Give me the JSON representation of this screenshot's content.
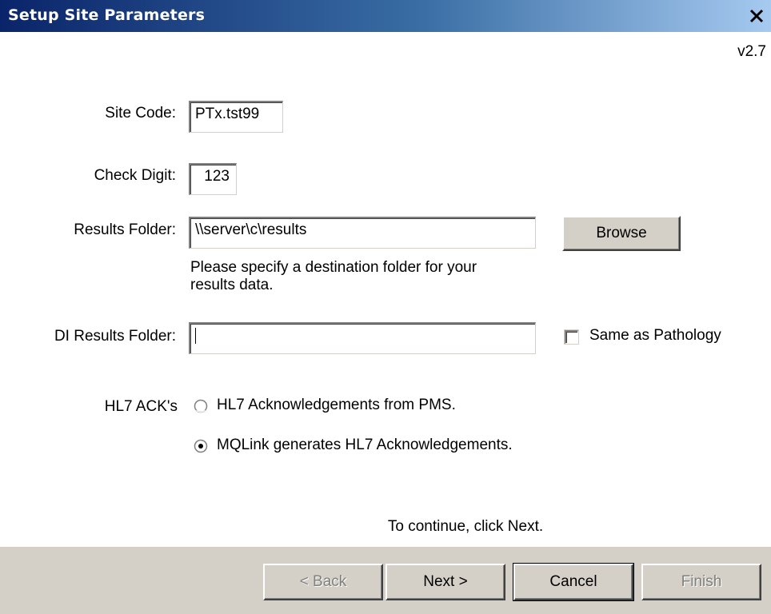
{
  "window": {
    "title": "Setup Site Parameters",
    "version": "v2.7"
  },
  "form": {
    "site_code": {
      "label": "Site Code:",
      "value": "PTx.tst99"
    },
    "check_digit": {
      "label": "Check Digit:",
      "value": "123"
    },
    "results_folder": {
      "label": "Results Folder:",
      "value": "\\\\server\\c\\results",
      "hint_line1": "Please specify a destination folder for your",
      "hint_line2": "results data.",
      "browse_label": "Browse"
    },
    "di_results_folder": {
      "label": "DI Results Folder:",
      "value": "",
      "same_as_label": "Same as Pathology",
      "same_as_checked": false
    },
    "hl7_acks": {
      "label": "HL7 ACK's",
      "options": [
        {
          "label": "HL7 Acknowledgements from PMS.",
          "selected": false
        },
        {
          "label": "MQLink generates HL7 Acknowledgements.",
          "selected": true
        }
      ]
    }
  },
  "instructions": "To continue, click Next.",
  "buttons": {
    "back": "< Back",
    "next": "Next >",
    "cancel": "Cancel",
    "finish": "Finish"
  },
  "icons": {
    "close": "close-icon",
    "checkbox": "checkbox-icon",
    "radio": "radio-icon"
  }
}
